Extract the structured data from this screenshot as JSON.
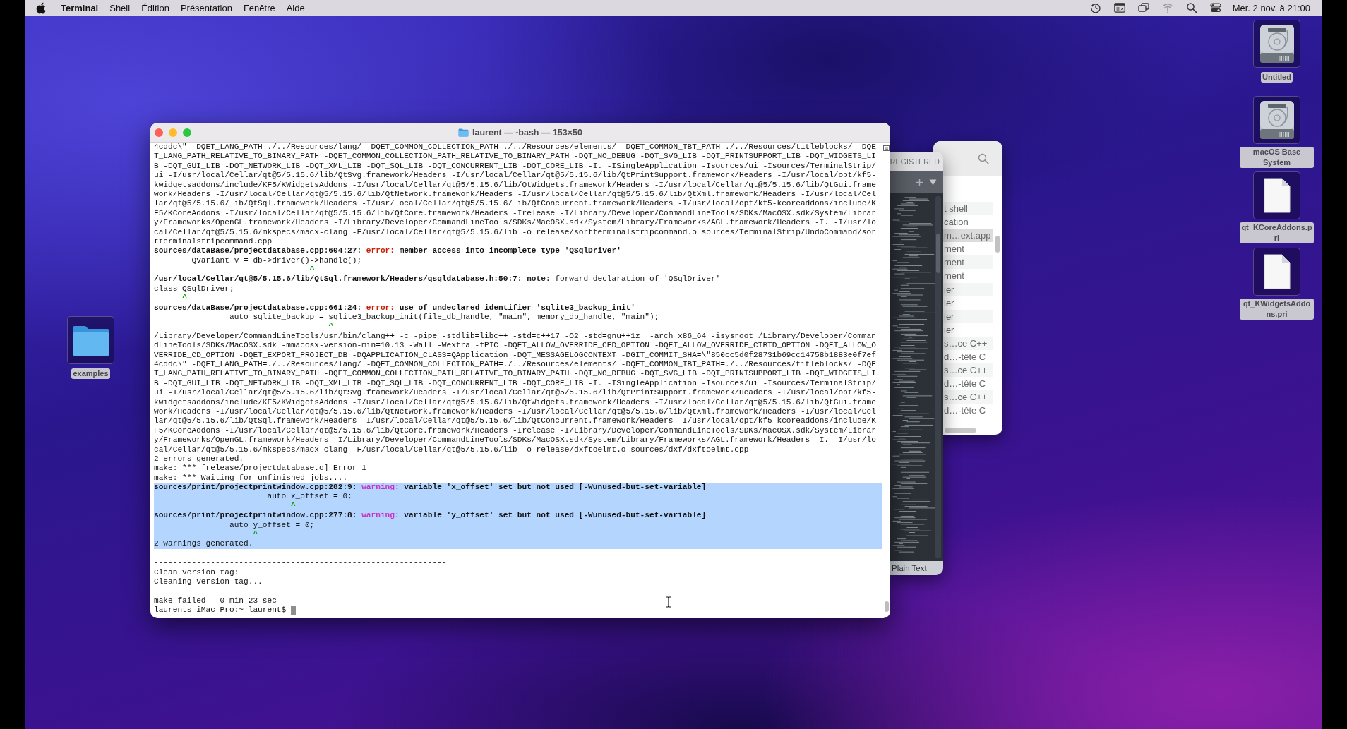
{
  "menu_bar": {
    "app_name": "Terminal",
    "menus": [
      "Shell",
      "Édition",
      "Présentation",
      "Fenêtre",
      "Aide"
    ],
    "clock": "Mer. 2 nov. à 21:00"
  },
  "terminal": {
    "title": "laurent — -bash — 153×50",
    "lines": [
      {
        "kind": "text",
        "text": "4cddc\\\" -DQET_LANG_PATH=./../Resources/lang/ -DQET_COMMON_COLLECTION_PATH=./../Resources/elements/ -DQET_COMMON_TBT_PATH=./../Resources/titleblocks/ -DQE",
        "selected": false
      },
      {
        "kind": "text",
        "text": "T_LANG_PATH_RELATIVE_TO_BINARY_PATH -DQET_COMMON_COLLECTION_PATH_RELATIVE_TO_BINARY_PATH -DQT_NO_DEBUG -DQT_SVG_LIB -DQT_PRINTSUPPORT_LIB -DQT_WIDGETS_LI",
        "selected": false
      },
      {
        "kind": "text",
        "text": "B -DQT_GUI_LIB -DQT_NETWORK_LIB -DQT_XML_LIB -DQT_SQL_LIB -DQT_CONCURRENT_LIB -DQT_CORE_LIB -I. -ISingleApplication -Isources/ui -Isources/TerminalStrip/",
        "selected": false
      },
      {
        "kind": "text",
        "text": "ui -I/usr/local/Cellar/qt@5/5.15.6/lib/QtSvg.framework/Headers -I/usr/local/Cellar/qt@5/5.15.6/lib/QtPrintSupport.framework/Headers -I/usr/local/opt/kf5-",
        "selected": false
      },
      {
        "kind": "text",
        "text": "kwidgetsaddons/include/KF5/KWidgetsAddons -I/usr/local/Cellar/qt@5/5.15.6/lib/QtWidgets.framework/Headers -I/usr/local/Cellar/qt@5/5.15.6/lib/QtGui.frame",
        "selected": false
      },
      {
        "kind": "text",
        "text": "work/Headers -I/usr/local/Cellar/qt@5/5.15.6/lib/QtNetwork.framework/Headers -I/usr/local/Cellar/qt@5/5.15.6/lib/QtXml.framework/Headers -I/usr/local/Cel",
        "selected": false
      },
      {
        "kind": "text",
        "text": "lar/qt@5/5.15.6/lib/QtSql.framework/Headers -I/usr/local/Cellar/qt@5/5.15.6/lib/QtConcurrent.framework/Headers -I/usr/local/opt/kf5-kcoreaddons/include/K",
        "selected": false
      },
      {
        "kind": "text",
        "text": "F5/KCoreAddons -I/usr/local/Cellar/qt@5/5.15.6/lib/QtCore.framework/Headers -Irelease -I/Library/Developer/CommandLineTools/SDKs/MacOSX.sdk/System/Librar",
        "selected": false
      },
      {
        "kind": "text",
        "text": "y/Frameworks/OpenGL.framework/Headers -I/Library/Developer/CommandLineTools/SDKs/MacOSX.sdk/System/Library/Frameworks/AGL.framework/Headers -I. -I/usr/lo",
        "selected": false
      },
      {
        "kind": "text",
        "text": "cal/Cellar/qt@5/5.15.6/mkspecs/macx-clang -F/usr/local/Cellar/qt@5/5.15.6/lib -o release/sortterminalstripcommand.o sources/TerminalStrip/UndoCommand/sor",
        "selected": false
      },
      {
        "kind": "text",
        "text": "tterminalstripcommand.cpp",
        "selected": false
      },
      {
        "kind": "error",
        "location": "sources/dataBase/projectdatabase.cpp:604:27:",
        "label": "error:",
        "message": "member access into incomplete type 'QSqlDriver'",
        "selected": false
      },
      {
        "kind": "text",
        "text": "        QVariant v = db->driver()->handle();",
        "selected": false
      },
      {
        "kind": "caret",
        "text": "                                 ^",
        "selected": false
      },
      {
        "kind": "note",
        "location": "/usr/local/Cellar/qt@5/5.15.6/lib/QtSql.framework/Headers/qsqldatabase.h:50:7:",
        "label": "note:",
        "message": "forward declaration of 'QSqlDriver'",
        "selected": false
      },
      {
        "kind": "text",
        "text": "class QSqlDriver;",
        "selected": false
      },
      {
        "kind": "caret",
        "text": "      ^",
        "selected": false
      },
      {
        "kind": "error",
        "location": "sources/dataBase/projectdatabase.cpp:661:24:",
        "label": "error:",
        "message": "use of undeclared identifier 'sqlite3_backup_init'",
        "selected": false
      },
      {
        "kind": "text",
        "text": "                auto sqlite_backup = sqlite3_backup_init(file_db_handle, \"main\", memory_db_handle, \"main\");",
        "selected": false
      },
      {
        "kind": "caret",
        "text": "                                     ^",
        "selected": false
      },
      {
        "kind": "text",
        "text": "/Library/Developer/CommandLineTools/usr/bin/clang++ -c -pipe -stdlib=libc++ -std=c++17 -O2 -std=gnu++1z  -arch x86_64 -isysroot /Library/Developer/Comman",
        "selected": false
      },
      {
        "kind": "text",
        "text": "dLineTools/SDKs/MacOSX.sdk -mmacosx-version-min=10.13 -Wall -Wextra -fPIC -DQET_ALLOW_OVERRIDE_CED_OPTION -DQET_ALLOW_OVERRIDE_CTBTD_OPTION -DQET_ALLOW_O",
        "selected": false
      },
      {
        "kind": "text",
        "text": "VERRIDE_CD_OPTION -DQET_EXPORT_PROJECT_DB -DQAPPLICATION_CLASS=QApplication -DQT_MESSAGELOGCONTEXT -DGIT_COMMIT_SHA=\\\"850cc5d0f28731b69cc14758b1883e0f7ef",
        "selected": false
      },
      {
        "kind": "text",
        "text": "4cddc\\\" -DQET_LANG_PATH=./../Resources/lang/ -DQET_COMMON_COLLECTION_PATH=./../Resources/elements/ -DQET_COMMON_TBT_PATH=./../Resources/titleblocks/ -DQE",
        "selected": false
      },
      {
        "kind": "text",
        "text": "T_LANG_PATH_RELATIVE_TO_BINARY_PATH -DQET_COMMON_COLLECTION_PATH_RELATIVE_TO_BINARY_PATH -DQT_NO_DEBUG -DQT_SVG_LIB -DQT_PRINTSUPPORT_LIB -DQT_WIDGETS_LI",
        "selected": false
      },
      {
        "kind": "text",
        "text": "B -DQT_GUI_LIB -DQT_NETWORK_LIB -DQT_XML_LIB -DQT_SQL_LIB -DQT_CONCURRENT_LIB -DQT_CORE_LIB -I. -ISingleApplication -Isources/ui -Isources/TerminalStrip/",
        "selected": false
      },
      {
        "kind": "text",
        "text": "ui -I/usr/local/Cellar/qt@5/5.15.6/lib/QtSvg.framework/Headers -I/usr/local/Cellar/qt@5/5.15.6/lib/QtPrintSupport.framework/Headers -I/usr/local/opt/kf5-",
        "selected": false
      },
      {
        "kind": "text",
        "text": "kwidgetsaddons/include/KF5/KWidgetsAddons -I/usr/local/Cellar/qt@5/5.15.6/lib/QtWidgets.framework/Headers -I/usr/local/Cellar/qt@5/5.15.6/lib/QtGui.frame",
        "selected": false
      },
      {
        "kind": "text",
        "text": "work/Headers -I/usr/local/Cellar/qt@5/5.15.6/lib/QtNetwork.framework/Headers -I/usr/local/Cellar/qt@5/5.15.6/lib/QtXml.framework/Headers -I/usr/local/Cel",
        "selected": false
      },
      {
        "kind": "text",
        "text": "lar/qt@5/5.15.6/lib/QtSql.framework/Headers -I/usr/local/Cellar/qt@5/5.15.6/lib/QtConcurrent.framework/Headers -I/usr/local/opt/kf5-kcoreaddons/include/K",
        "selected": false
      },
      {
        "kind": "text",
        "text": "F5/KCoreAddons -I/usr/local/Cellar/qt@5/5.15.6/lib/QtCore.framework/Headers -Irelease -I/Library/Developer/CommandLineTools/SDKs/MacOSX.sdk/System/Librar",
        "selected": false
      },
      {
        "kind": "text",
        "text": "y/Frameworks/OpenGL.framework/Headers -I/Library/Developer/CommandLineTools/SDKs/MacOSX.sdk/System/Library/Frameworks/AGL.framework/Headers -I. -I/usr/lo",
        "selected": false
      },
      {
        "kind": "text",
        "text": "cal/Cellar/qt@5/5.15.6/mkspecs/macx-clang -F/usr/local/Cellar/qt@5/5.15.6/lib -o release/dxftoelmt.o sources/dxf/dxftoelmt.cpp",
        "selected": false
      },
      {
        "kind": "text",
        "text": "2 errors generated.",
        "selected": false
      },
      {
        "kind": "text",
        "text": "make: *** [release/projectdatabase.o] Error 1",
        "selected": false
      },
      {
        "kind": "text",
        "text": "make: *** Waiting for unfinished jobs....",
        "selected": false
      },
      {
        "kind": "warning",
        "location": "sources/print/projectprintwindow.cpp:282:9:",
        "label": "warning:",
        "message": "variable 'x_offset' set but not used [-Wunused-but-set-variable]",
        "selected": true
      },
      {
        "kind": "text",
        "text": "                        auto x_offset = 0;",
        "selected": true
      },
      {
        "kind": "caret",
        "text": "                             ^",
        "selected": true
      },
      {
        "kind": "warning",
        "location": "sources/print/projectprintwindow.cpp:277:8:",
        "label": "warning:",
        "message": "variable 'y_offset' set but not used [-Wunused-but-set-variable]",
        "selected": true
      },
      {
        "kind": "text",
        "text": "                auto y_offset = 0;",
        "selected": true
      },
      {
        "kind": "caret",
        "text": "                     ^",
        "selected": true
      },
      {
        "kind": "text",
        "text": "2 warnings generated.",
        "selected": true
      },
      {
        "kind": "blank",
        "selected": false
      },
      {
        "kind": "text",
        "text": "--------------------------------------------------------------",
        "selected": false
      },
      {
        "kind": "text",
        "text": "Clean version tag:",
        "selected": false
      },
      {
        "kind": "text",
        "text": "Cleaning version tag...",
        "selected": false
      },
      {
        "kind": "blank",
        "selected": false
      },
      {
        "kind": "text",
        "text": "make failed - 0 min 23 sec",
        "selected": false
      },
      {
        "kind": "prompt",
        "text": "laurents-iMac-Pro:~ laurent$",
        "selected": false
      }
    ]
  },
  "editor_window": {
    "tab_label": "REGISTERED",
    "syntax_label": "Plain Text"
  },
  "list_window": {
    "rows": [
      {
        "text": "t shell",
        "selected": false
      },
      {
        "text": "cation",
        "selected": false
      },
      {
        "text": "m…ext.app",
        "selected": true
      },
      {
        "text": "ment",
        "selected": false
      },
      {
        "text": "ment",
        "selected": false
      },
      {
        "text": "ment",
        "selected": false
      },
      {
        "text": "ier",
        "selected": false
      },
      {
        "text": "ier",
        "selected": false
      },
      {
        "text": "ier",
        "selected": false
      },
      {
        "text": "ier",
        "selected": false
      },
      {
        "text": "s…ce C++",
        "selected": false
      },
      {
        "text": "d…-tête C",
        "selected": false
      },
      {
        "text": "s…ce C++",
        "selected": false
      },
      {
        "text": "d…-tête C",
        "selected": false
      },
      {
        "text": "s…ce C++",
        "selected": false
      },
      {
        "text": "d…-tête C",
        "selected": false
      }
    ]
  },
  "desktop_icons_left": [
    {
      "kind": "folder",
      "label": "examples",
      "selected": true
    }
  ],
  "desktop_icons_right": [
    {
      "kind": "drive",
      "label": "Untitled",
      "selected": true
    },
    {
      "kind": "drive",
      "label": "macOS Base System",
      "selected": true
    },
    {
      "kind": "document",
      "label": "qt_KCoreAddons.pri",
      "selected": true
    },
    {
      "kind": "document",
      "label": "qt_KWidgetsAddons.pri",
      "selected": true
    }
  ]
}
